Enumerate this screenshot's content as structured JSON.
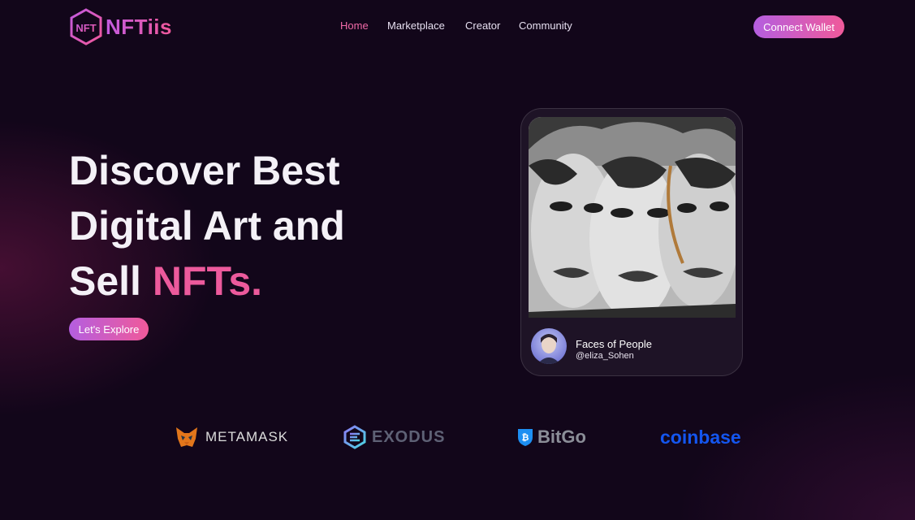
{
  "brand": {
    "name": "NFTiis",
    "logo_mark": "NFT"
  },
  "nav": {
    "items": [
      {
        "label": "Home",
        "active": true
      },
      {
        "label": "Marketplace",
        "active": false
      },
      {
        "label": "Creator",
        "active": false
      },
      {
        "label": "Community",
        "active": false
      }
    ]
  },
  "header": {
    "connect_label": "Connect Wallet"
  },
  "hero": {
    "line1": "Discover Best",
    "line2": "Digital Art and",
    "line3_plain": "Sell ",
    "line3_accent": "NFTs.",
    "cta_label": "Let's Explore"
  },
  "card": {
    "title": "Faces of People",
    "handle": "@eliza_Sohen"
  },
  "partners": [
    {
      "name": "METAMASK",
      "icon": "fox-icon"
    },
    {
      "name": "EXODUS",
      "icon": "exodus-icon"
    },
    {
      "name": "BitGo",
      "icon": "shield-icon"
    },
    {
      "name": "coinbase",
      "icon": ""
    }
  ],
  "colors": {
    "accent": "#ec5a9c",
    "gradient_start": "#b45ee0",
    "gradient_end": "#f05a9a",
    "background": "#12061a",
    "coinbase_blue": "#1456f0"
  }
}
